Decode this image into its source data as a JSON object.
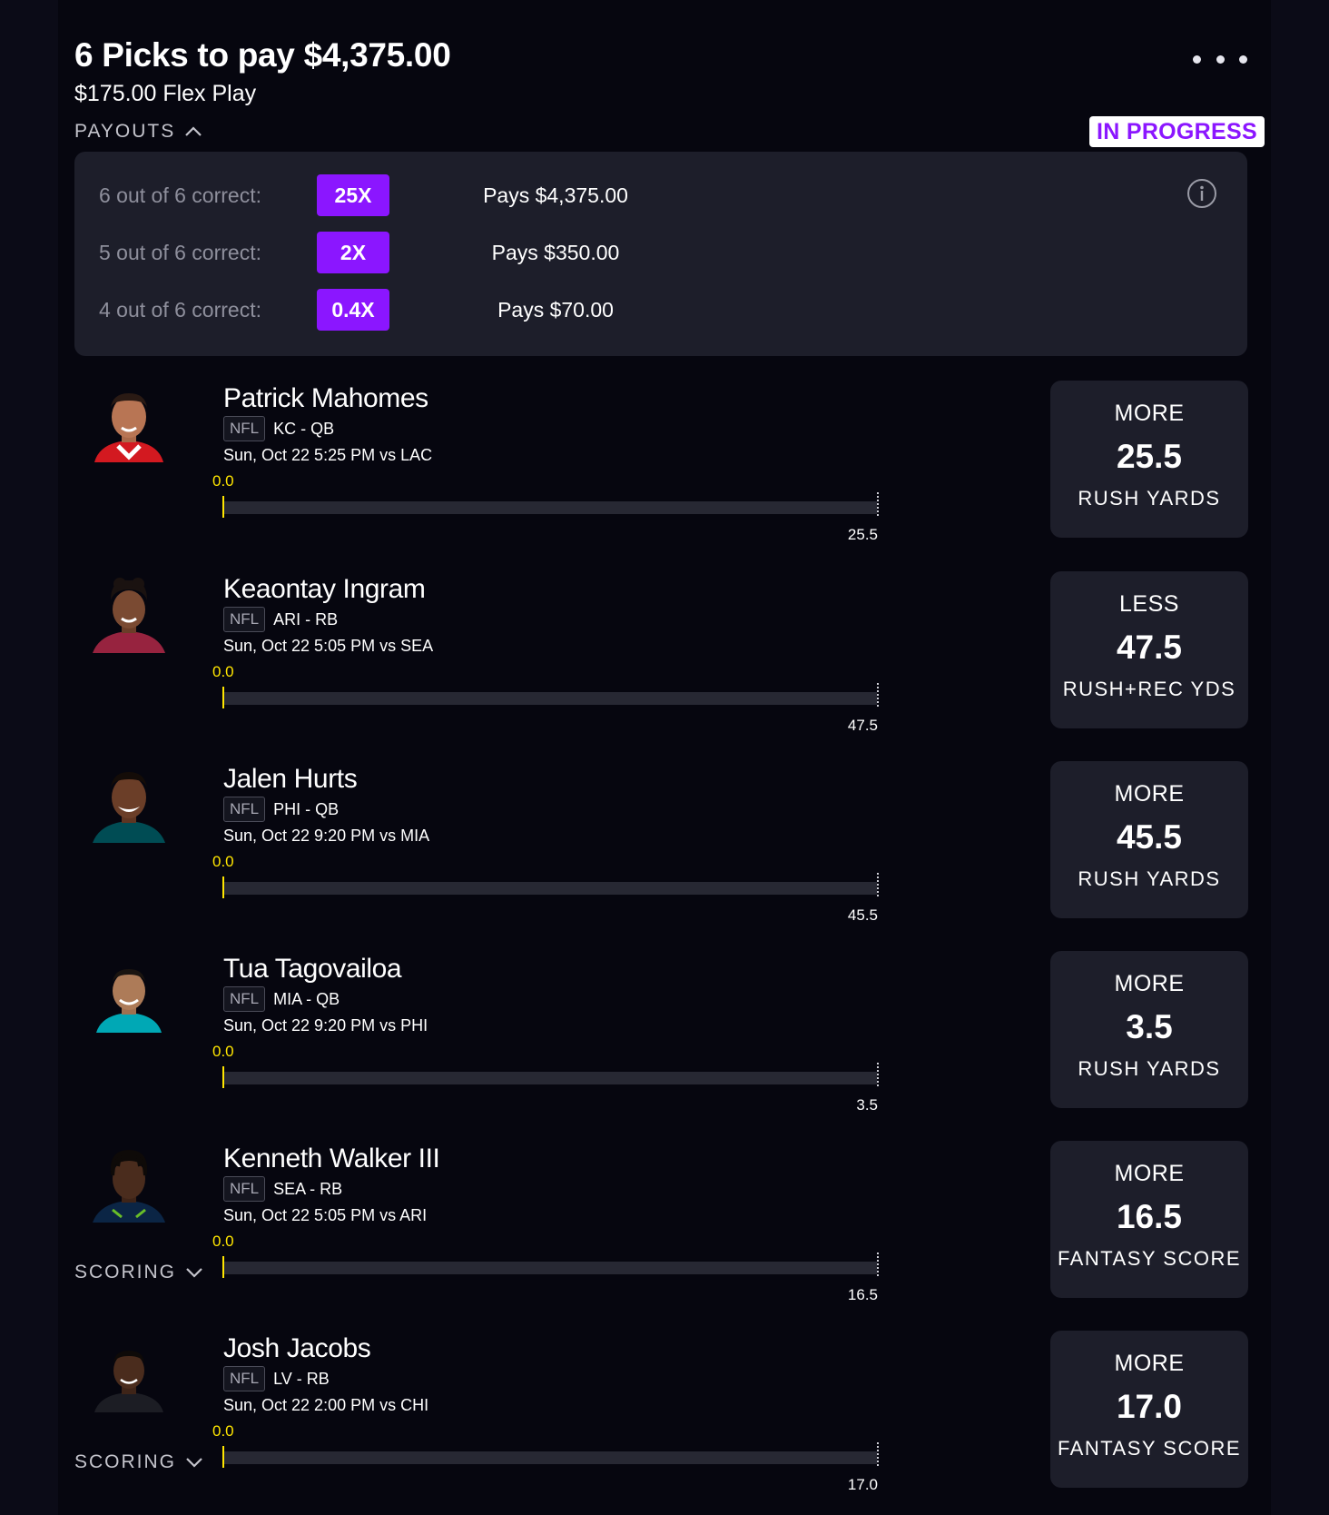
{
  "header": {
    "title": "6 Picks to pay $4,375.00",
    "subtitle": "$175.00 Flex Play",
    "payouts_label": "PAYOUTS",
    "status": "IN PROGRESS"
  },
  "payouts": [
    {
      "label": "6 out of 6 correct:",
      "multiplier": "25X",
      "pays": "Pays $4,375.00"
    },
    {
      "label": "5 out of 6 correct:",
      "multiplier": "2X",
      "pays": "Pays $350.00"
    },
    {
      "label": "4 out of 6 correct:",
      "multiplier": "0.4X",
      "pays": "Pays $70.00"
    }
  ],
  "picks": [
    {
      "name": "Patrick Mahomes",
      "league": "NFL",
      "team_pos": "KC - QB",
      "game": "Sun, Oct 22 5:25 PM  vs LAC",
      "current": "0.0",
      "target": "25.5",
      "direction": "MORE",
      "line": "25.5",
      "stat": "RUSH YARDS",
      "scoring": ""
    },
    {
      "name": "Keaontay Ingram",
      "league": "NFL",
      "team_pos": "ARI - RB",
      "game": "Sun, Oct 22 5:05 PM  vs SEA",
      "current": "0.0",
      "target": "47.5",
      "direction": "LESS",
      "line": "47.5",
      "stat": "RUSH+REC YDS",
      "scoring": ""
    },
    {
      "name": "Jalen Hurts",
      "league": "NFL",
      "team_pos": "PHI - QB",
      "game": "Sun, Oct 22 9:20 PM  vs MIA",
      "current": "0.0",
      "target": "45.5",
      "direction": "MORE",
      "line": "45.5",
      "stat": "RUSH YARDS",
      "scoring": ""
    },
    {
      "name": "Tua Tagovailoa",
      "league": "NFL",
      "team_pos": "MIA - QB",
      "game": "Sun, Oct 22 9:20 PM  vs PHI",
      "current": "0.0",
      "target": "3.5",
      "direction": "MORE",
      "line": "3.5",
      "stat": "RUSH YARDS",
      "scoring": ""
    },
    {
      "name": "Kenneth Walker III",
      "league": "NFL",
      "team_pos": "SEA - RB",
      "game": "Sun, Oct 22 5:05 PM  vs ARI",
      "current": "0.0",
      "target": "16.5",
      "direction": "MORE",
      "line": "16.5",
      "stat": "FANTASY SCORE",
      "scoring": "SCORING"
    },
    {
      "name": "Josh Jacobs",
      "league": "NFL",
      "team_pos": "LV - RB",
      "game": "Sun, Oct 22 2:00 PM  vs CHI",
      "current": "0.0",
      "target": "17.0",
      "direction": "MORE",
      "line": "17.0",
      "stat": "FANTASY SCORE",
      "scoring": "SCORING"
    }
  ],
  "colors": {
    "accent": "#8b16ff",
    "progress_marker": "#ffe600",
    "background": "#06060f",
    "panel": "#1d1e2a"
  }
}
